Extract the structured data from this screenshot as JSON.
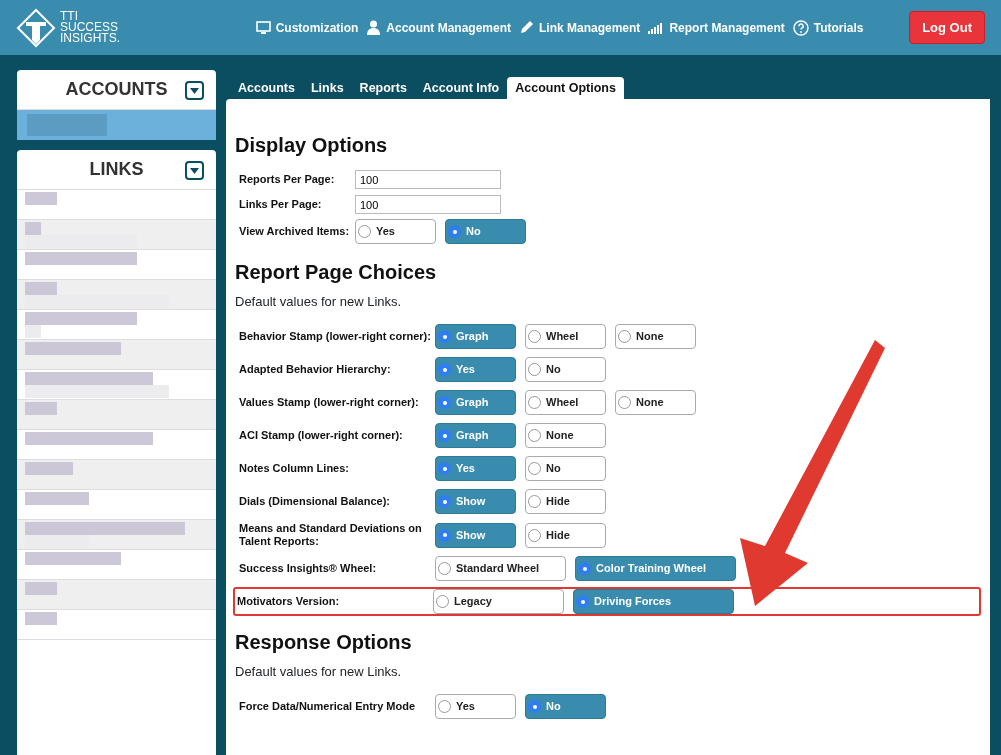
{
  "header": {
    "logo_lines": [
      "TTI",
      "SUCCESS",
      "INSIGHTS."
    ],
    "nav": [
      {
        "label": "Customization"
      },
      {
        "label": "Account Management"
      },
      {
        "label": "Link Management"
      },
      {
        "label": "Report Management"
      },
      {
        "label": "Tutorials"
      }
    ],
    "logout": "Log Out"
  },
  "sidebar": {
    "panels": [
      {
        "title": "ACCOUNTS",
        "kind": "accounts"
      },
      {
        "title": "LINKS",
        "kind": "links"
      }
    ]
  },
  "tabs": [
    {
      "label": "Accounts",
      "selected": false
    },
    {
      "label": "Links",
      "selected": false
    },
    {
      "label": "Reports",
      "selected": false
    },
    {
      "label": "Account Info",
      "selected": false
    },
    {
      "label": "Account Options",
      "selected": true
    }
  ],
  "sections": [
    {
      "title": "Display Options",
      "rows": [
        {
          "kind": "text",
          "label": "Reports Per Page:",
          "value": "100"
        },
        {
          "kind": "text",
          "label": "Links Per Page:",
          "value": "100"
        },
        {
          "kind": "radio",
          "label": "View Archived Items:",
          "wide": false,
          "highlighted": false,
          "options": [
            {
              "label": "Yes",
              "selected": false
            },
            {
              "label": "No",
              "selected": true
            }
          ]
        }
      ]
    },
    {
      "title": "Report Page Choices",
      "note": "Default values for new Links.",
      "rows": [
        {
          "kind": "radio",
          "label": "Behavior Stamp (lower-right corner):",
          "wide": false,
          "highlighted": false,
          "options": [
            {
              "label": "Graph",
              "selected": true
            },
            {
              "label": "Wheel",
              "selected": false
            },
            {
              "label": "None",
              "selected": false
            }
          ]
        },
        {
          "kind": "radio",
          "label": "Adapted Behavior Hierarchy:",
          "wide": false,
          "highlighted": false,
          "options": [
            {
              "label": "Yes",
              "selected": true
            },
            {
              "label": "No",
              "selected": false
            }
          ]
        },
        {
          "kind": "radio",
          "label": "Values Stamp (lower-right corner):",
          "wide": false,
          "highlighted": false,
          "options": [
            {
              "label": "Graph",
              "selected": true
            },
            {
              "label": "Wheel",
              "selected": false
            },
            {
              "label": "None",
              "selected": false
            }
          ]
        },
        {
          "kind": "radio",
          "label": "ACI Stamp (lower-right corner):",
          "wide": false,
          "highlighted": false,
          "options": [
            {
              "label": "Graph",
              "selected": true
            },
            {
              "label": "None",
              "selected": false
            }
          ]
        },
        {
          "kind": "radio",
          "label": "Notes Column Lines:",
          "wide": false,
          "highlighted": false,
          "options": [
            {
              "label": "Yes",
              "selected": true
            },
            {
              "label": "No",
              "selected": false
            }
          ]
        },
        {
          "kind": "radio",
          "label": "Dials (Dimensional Balance):",
          "wide": false,
          "highlighted": false,
          "options": [
            {
              "label": "Show",
              "selected": true
            },
            {
              "label": "Hide",
              "selected": false
            }
          ]
        },
        {
          "kind": "radio",
          "label": "Means and Standard Deviations on Talent Reports:",
          "wide": false,
          "highlighted": false,
          "options": [
            {
              "label": "Show",
              "selected": true
            },
            {
              "label": "Hide",
              "selected": false
            }
          ]
        },
        {
          "kind": "radio",
          "label": "Success Insights® Wheel:",
          "wide": true,
          "highlighted": false,
          "options": [
            {
              "label": "Standard Wheel",
              "selected": false
            },
            {
              "label": "Color Training Wheel",
              "selected": true
            }
          ]
        },
        {
          "kind": "radio",
          "label": "Motivators Version:",
          "wide": true,
          "highlighted": true,
          "options": [
            {
              "label": "Legacy",
              "selected": false
            },
            {
              "label": "Driving Forces",
              "selected": true
            }
          ]
        }
      ]
    },
    {
      "title": "Response Options",
      "note": "Default values for new Links.",
      "rows": [
        {
          "kind": "radio",
          "label": "Force Data/Numerical Entry Mode",
          "wide": false,
          "highlighted": false,
          "options": [
            {
              "label": "Yes",
              "selected": false
            },
            {
              "label": "No",
              "selected": true
            }
          ]
        }
      ]
    }
  ],
  "annotation": {
    "arrow": true
  }
}
